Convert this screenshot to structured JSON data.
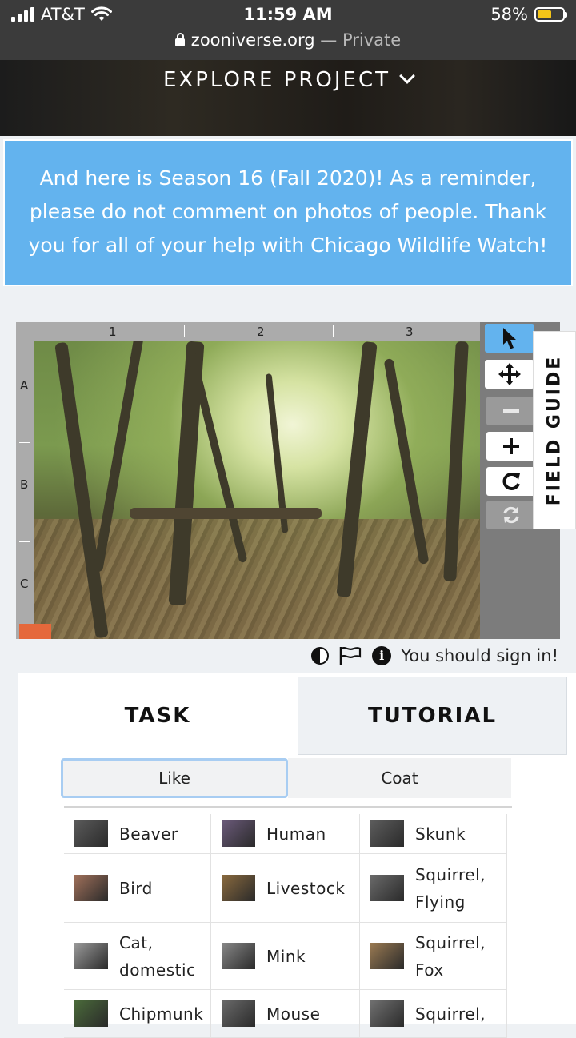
{
  "status_bar": {
    "carrier": "AT&T",
    "time": "11:59 AM",
    "battery_percent": "58%",
    "battery_level": 0.58
  },
  "url_bar": {
    "domain": "zooniverse.org",
    "separator": " — ",
    "mode": "Private"
  },
  "project_nav": {
    "label": "EXPLORE PROJECT"
  },
  "announcement": {
    "text": "And here is Season 16 (Fall 2020)! As a reminder, please do not comment on photos of people. Thank you for all of your help with Chicago Wildlife Watch!"
  },
  "viewer": {
    "columns": [
      "1",
      "2",
      "3"
    ],
    "rows": [
      "A",
      "B",
      "C"
    ],
    "tools": [
      "pointer-icon",
      "move-icon",
      "zoom-out-icon",
      "zoom-in-icon",
      "rotate-icon",
      "reset-icon"
    ]
  },
  "field_guide": {
    "label": "FIELD GUIDE"
  },
  "meta": {
    "sign_in": "You should sign in!"
  },
  "tabs": {
    "task": "TASK",
    "tutorial": "TUTORIAL"
  },
  "filters": {
    "like": "Like",
    "coat": "Coat"
  },
  "species": [
    {
      "name": "Beaver",
      "thumb": "#5a5a5a"
    },
    {
      "name": "Human",
      "thumb": "#6b5a7a"
    },
    {
      "name": "Skunk",
      "thumb": "#5c5c5c"
    },
    {
      "name": "Bird",
      "thumb": "#a0705a"
    },
    {
      "name": "Livestock",
      "thumb": "#8a6a3e"
    },
    {
      "name": "Squirrel,\nFlying",
      "thumb": "#6a6a6a"
    },
    {
      "name": "Cat,\ndomestic",
      "thumb": "#9a9a9a"
    },
    {
      "name": "Mink",
      "thumb": "#888888"
    },
    {
      "name": "Squirrel,\nFox",
      "thumb": "#9a7a52"
    },
    {
      "name": "Chipmunk",
      "thumb": "#4a6a3a"
    },
    {
      "name": "Mouse",
      "thumb": "#6a6a6a"
    },
    {
      "name": "Squirrel,",
      "thumb": "#707070"
    }
  ]
}
